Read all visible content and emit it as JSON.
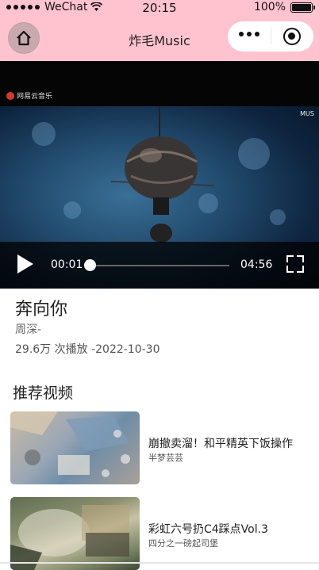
{
  "status_bar": {
    "carrier": "WeChat",
    "time": "20:15",
    "battery": "100%"
  },
  "nav": {
    "title": "炸毛Music",
    "home_icon": "home-icon",
    "more_icon": "more-dots-icon",
    "close_icon": "target-circle-icon"
  },
  "player": {
    "watermark": "网易云音乐",
    "corner_mark": "MUS",
    "current_time": "00:01",
    "duration": "04:56",
    "progress": 0.0
  },
  "song": {
    "title": "奔向你",
    "singer": "周深-",
    "stats": "29.6万 次播放 -2022-10-30"
  },
  "recommend": {
    "section_title": "推荐视频",
    "items": [
      {
        "title": "崩撤卖溜！和平精英下饭操作",
        "author": "半梦芸芸"
      },
      {
        "title": "彩虹六号扔C4踩点Vol.3",
        "author": "四分之一磅起司堡"
      }
    ]
  },
  "colors": {
    "nav_bg": "#ffc3cf",
    "video_bg": "#050505"
  }
}
